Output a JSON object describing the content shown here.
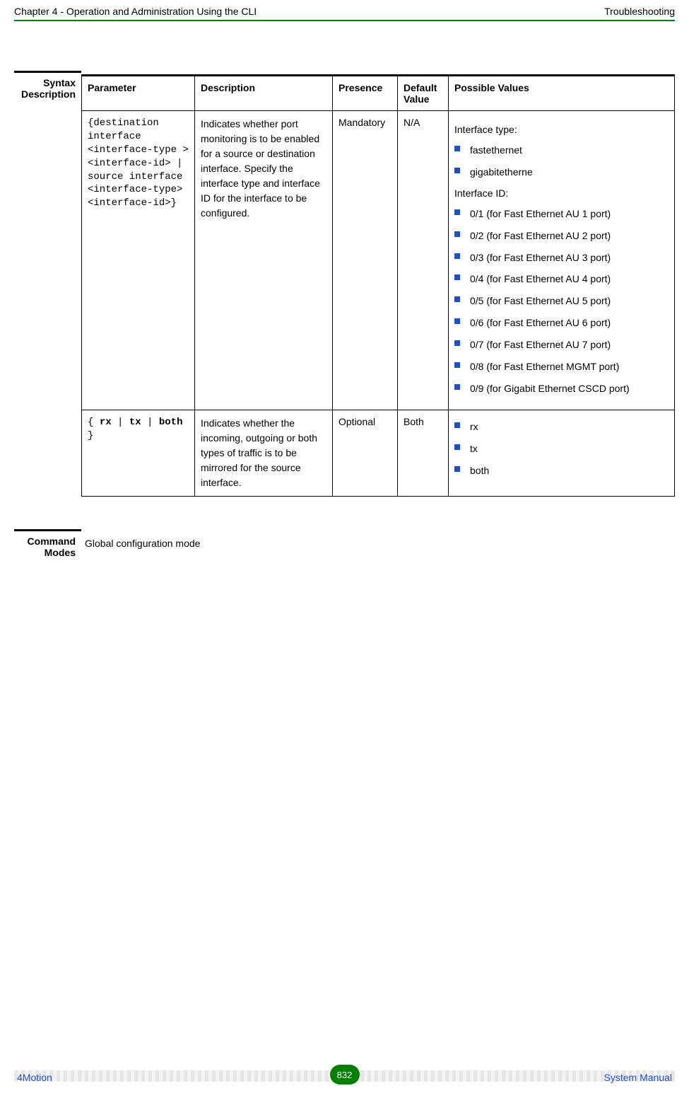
{
  "header": {
    "left": "Chapter 4 - Operation and Administration Using the CLI",
    "right": "Troubleshooting"
  },
  "leftLabels": {
    "syntax1": "Syntax",
    "syntax2": "Description",
    "modes1": "Command",
    "modes2": "Modes"
  },
  "table": {
    "headers": {
      "param": "Parameter",
      "desc": "Description",
      "presence": "Presence",
      "default": "Default Value",
      "possible": "Possible Values"
    },
    "row1": {
      "param": "{destination interface <interface-type > <interface-id> | source interface <interface-type> <interface-id>}",
      "desc": "Indicates whether port monitoring is to be enabled for a source or destination interface. Specify the interface type and interface ID for the interface to be configured.",
      "presence": "Mandatory",
      "default": "N/A",
      "iface_type_label": "Interface type:",
      "iface_type_items": [
        "fastethernet",
        "gigabitetherne"
      ],
      "iface_id_label": "Interface ID:",
      "iface_id_items": [
        "0/1 (for Fast Ethernet AU 1 port)",
        "0/2 (for Fast Ethernet AU 2 port)",
        "0/3 (for Fast Ethernet AU 3 port)",
        "0/4 (for Fast Ethernet AU 4 port)",
        "0/5 (for Fast Ethernet AU 5 port)",
        "0/6 (for Fast Ethernet AU 6 port)",
        "0/7 (for Fast Ethernet AU 7 port)",
        "0/8 (for Fast Ethernet MGMT port)",
        "0/9 (for Gigabit Ethernet CSCD port)"
      ]
    },
    "row2": {
      "param_prefix": "{ ",
      "param_rx": "rx",
      "param_sep1": " | ",
      "param_tx": "tx",
      "param_sep2": " | ",
      "param_both": "both",
      "param_suffix": " }",
      "desc": "Indicates whether the incoming, outgoing or both types of traffic is to be mirrored for the source interface.",
      "presence": "Optional",
      "default": "Both",
      "items": [
        "rx",
        "tx",
        "both"
      ]
    }
  },
  "modesText": "Global configuration mode",
  "footer": {
    "left": "4Motion",
    "page": "832",
    "right": "System Manual"
  }
}
